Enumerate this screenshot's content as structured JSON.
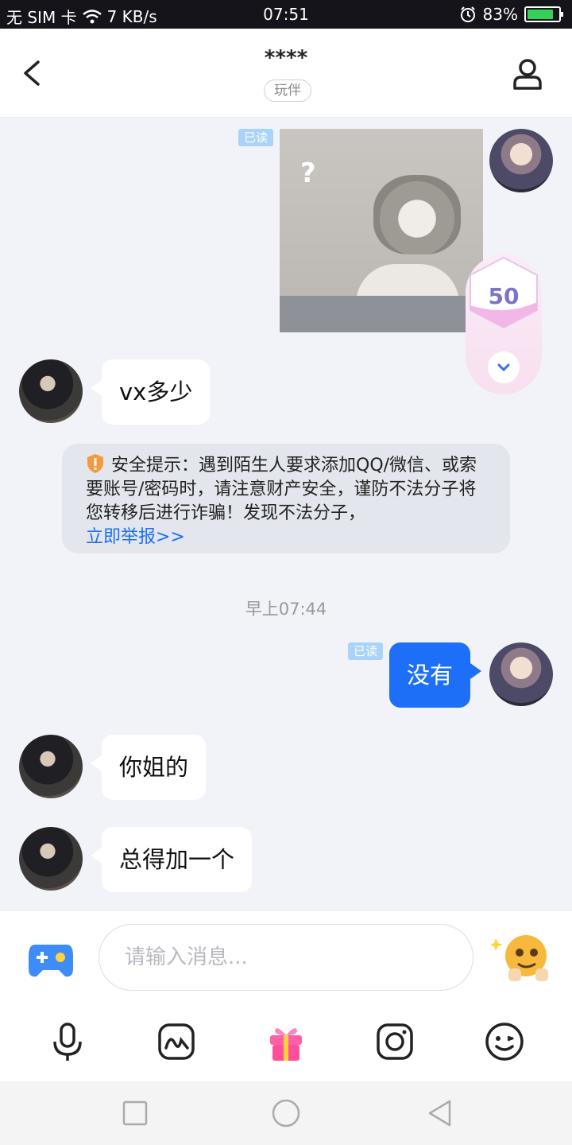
{
  "status_bar": {
    "carrier": "无 SIM 卡",
    "net_speed": "7 KB/s",
    "time": "07:51",
    "battery": "83%",
    "battery_level": 0.83
  },
  "header": {
    "title": "****",
    "tag": "玩伴"
  },
  "messages": {
    "read_label_1": "已读",
    "bubble_1": "vx多少",
    "notice_text": "安全提示：遇到陌生人要求添加QQ/微信、或索要账号/密码时，请注意财产安全，谨防不法分子将您转移后进行诈骗！发现不法分子，",
    "notice_link": "立即举报>>",
    "timestamp": "早上07:44",
    "read_label_2": "已读",
    "bubble_2": "没有",
    "bubble_3": "你姐的",
    "bubble_4": "总得加一个"
  },
  "intimacy": {
    "value": "50"
  },
  "input": {
    "placeholder": "请输入消息..."
  },
  "colors": {
    "accent": "#1e6ff8",
    "read_badge": "#a9d3f8",
    "intimacy_text": "#7b74c9"
  }
}
